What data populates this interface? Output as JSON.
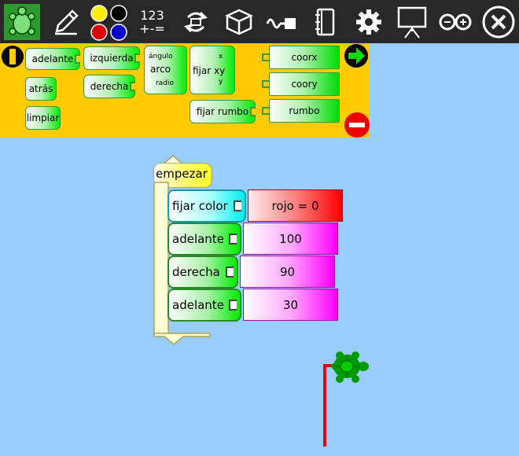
{
  "toolbar": {
    "calc_label_top": "123",
    "calc_label_bottom": "+-=",
    "pen_colors": [
      "#ffee00",
      "#000000",
      "#dd0000",
      "#0000cc"
    ]
  },
  "palette": {
    "forward": "adelante",
    "back": "atrás",
    "clear": "limpiar",
    "left": "izquierda",
    "right": "derecha",
    "arc_angle": "ángulo",
    "arc": "arco",
    "arc_radius": "radio",
    "setxy": "fijar xy",
    "setxy_x": "x",
    "setxy_y": "y",
    "setheading": "fijar rumbo",
    "xcor": "coorx",
    "ycor": "coory",
    "heading": "rumbo"
  },
  "program": {
    "start": "empezar",
    "setcolor": "fijar color",
    "setcolor_value": "rojo = 0",
    "steps": [
      {
        "label": "adelante",
        "value": "100"
      },
      {
        "label": "derecha",
        "value": "90"
      },
      {
        "label": "adelante",
        "value": "30"
      }
    ]
  },
  "colors": {
    "toolbar_bg": "#282828",
    "palette_bg": "#ffcc00",
    "canvas_bg": "#99ccff",
    "turtle": "#009900",
    "trail": "#ee0000"
  }
}
